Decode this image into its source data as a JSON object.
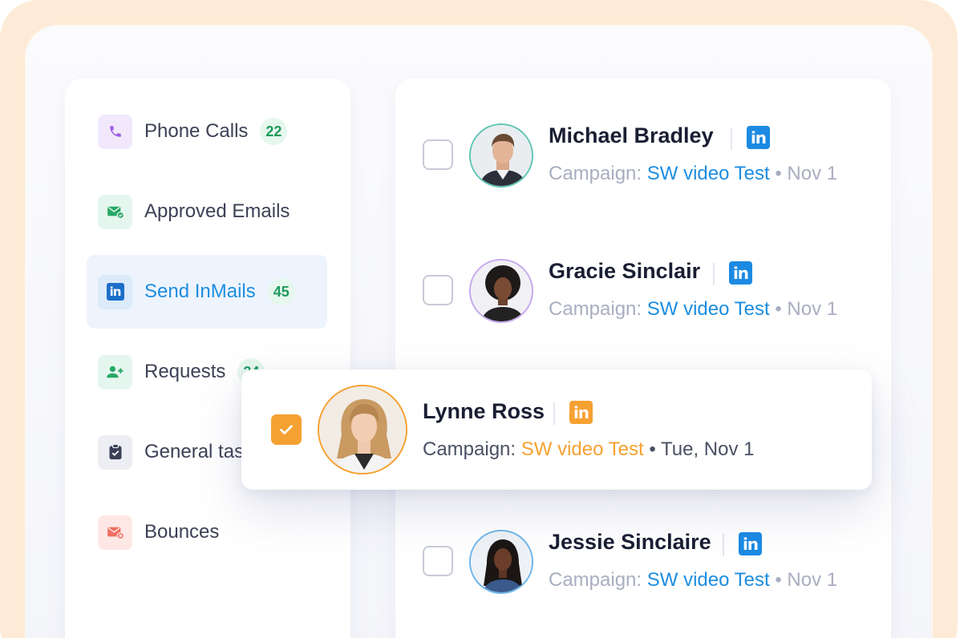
{
  "sidebar": {
    "items": [
      {
        "label": "Phone Calls",
        "count": "22",
        "icon": "phone-icon"
      },
      {
        "label": "Approved Emails",
        "count": "",
        "icon": "mail-check-icon"
      },
      {
        "label": "Send InMails",
        "count": "45",
        "icon": "linkedin-icon"
      },
      {
        "label": "Requests",
        "count": "24",
        "icon": "add-user-icon"
      },
      {
        "label": "General tasks",
        "count": "",
        "icon": "clipboard-check-icon"
      },
      {
        "label": "Bounces",
        "count": "",
        "icon": "mail-bounce-icon"
      }
    ],
    "active_index": 2
  },
  "list": {
    "rows": [
      {
        "name": "Michael Bradley",
        "campaign_prefix": "Campaign: ",
        "campaign": "SW video Test",
        "date": " • Nov 1",
        "checked": false
      },
      {
        "name": "Gracie Sinclair",
        "campaign_prefix": "Campaign: ",
        "campaign": "SW video Test",
        "date": " • Nov 1",
        "checked": false
      },
      {
        "name": "Jessie Sinclaire",
        "campaign_prefix": "Campaign: ",
        "campaign": "SW video Test",
        "date": " • Nov 1",
        "checked": false
      }
    ]
  },
  "selected_card": {
    "name": "Lynne Ross",
    "campaign_prefix": "Campaign: ",
    "campaign": "SW video Test",
    "date": " • Tue, Nov 1",
    "checked": true
  },
  "linkedin_badge_text": "in",
  "colors": {
    "accent_blue": "#1d8de0",
    "accent_orange": "#f5a132",
    "count_green": "#1e9a5b",
    "frame_peach": "#fdebd7"
  }
}
